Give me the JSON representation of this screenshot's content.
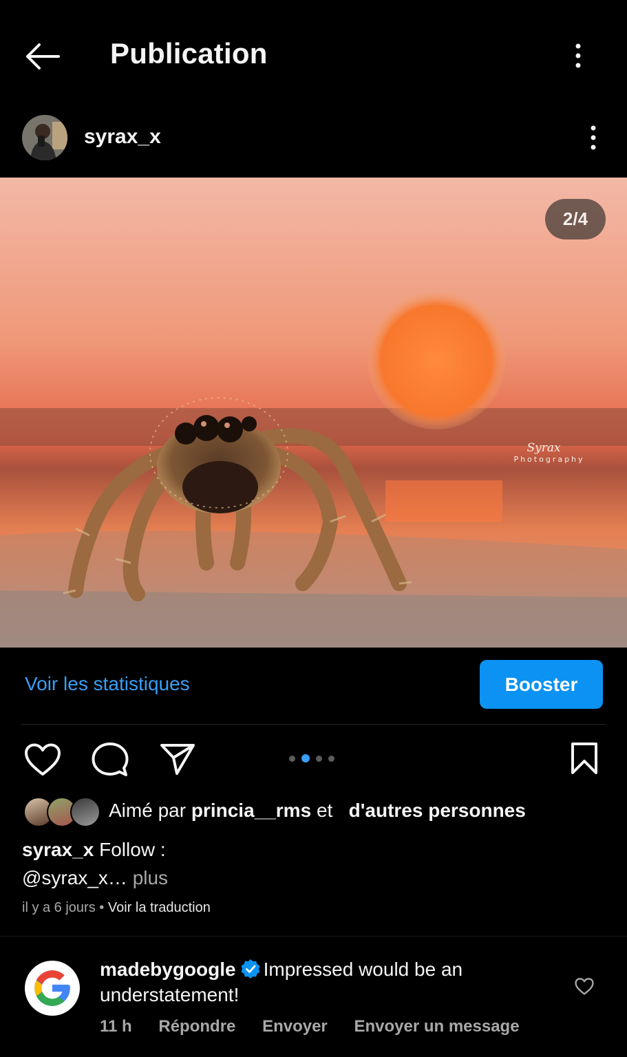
{
  "header": {
    "title": "Publication",
    "back_icon": "arrow-left-icon",
    "more_icon": "vertical-dots-icon"
  },
  "post": {
    "author": "syrax_x",
    "more_icon": "vertical-dots-icon",
    "photo": {
      "counter": "2/4",
      "watermark_line1": "Syrax",
      "watermark_line2": "Photography"
    },
    "insights_link": "Voir les statistiques",
    "boost_button": "Booster",
    "carousel": {
      "total": 4,
      "active": 2
    },
    "likes": {
      "prefix": "Aimé par",
      "user": "princia__rms",
      "connector": "et",
      "others": "d'autres personnes"
    },
    "caption": {
      "author": "syrax_x",
      "text_line1": "Follow :",
      "text_line2": "@syrax_x…",
      "more": "plus"
    },
    "meta": {
      "time": "il y a 6 jours",
      "separator": "•",
      "translate": "Voir la traduction"
    }
  },
  "comment": {
    "author": "madebygoogle",
    "text": "Impressed would be an understatement!",
    "time": "11 h",
    "reply": "Répondre",
    "send": "Envoyer",
    "send_message": "Envoyer un message"
  },
  "colors": {
    "accent": "#0b92f3",
    "link": "#3a9ef5",
    "background": "#000000",
    "muted_text": "#a8a8a8"
  }
}
